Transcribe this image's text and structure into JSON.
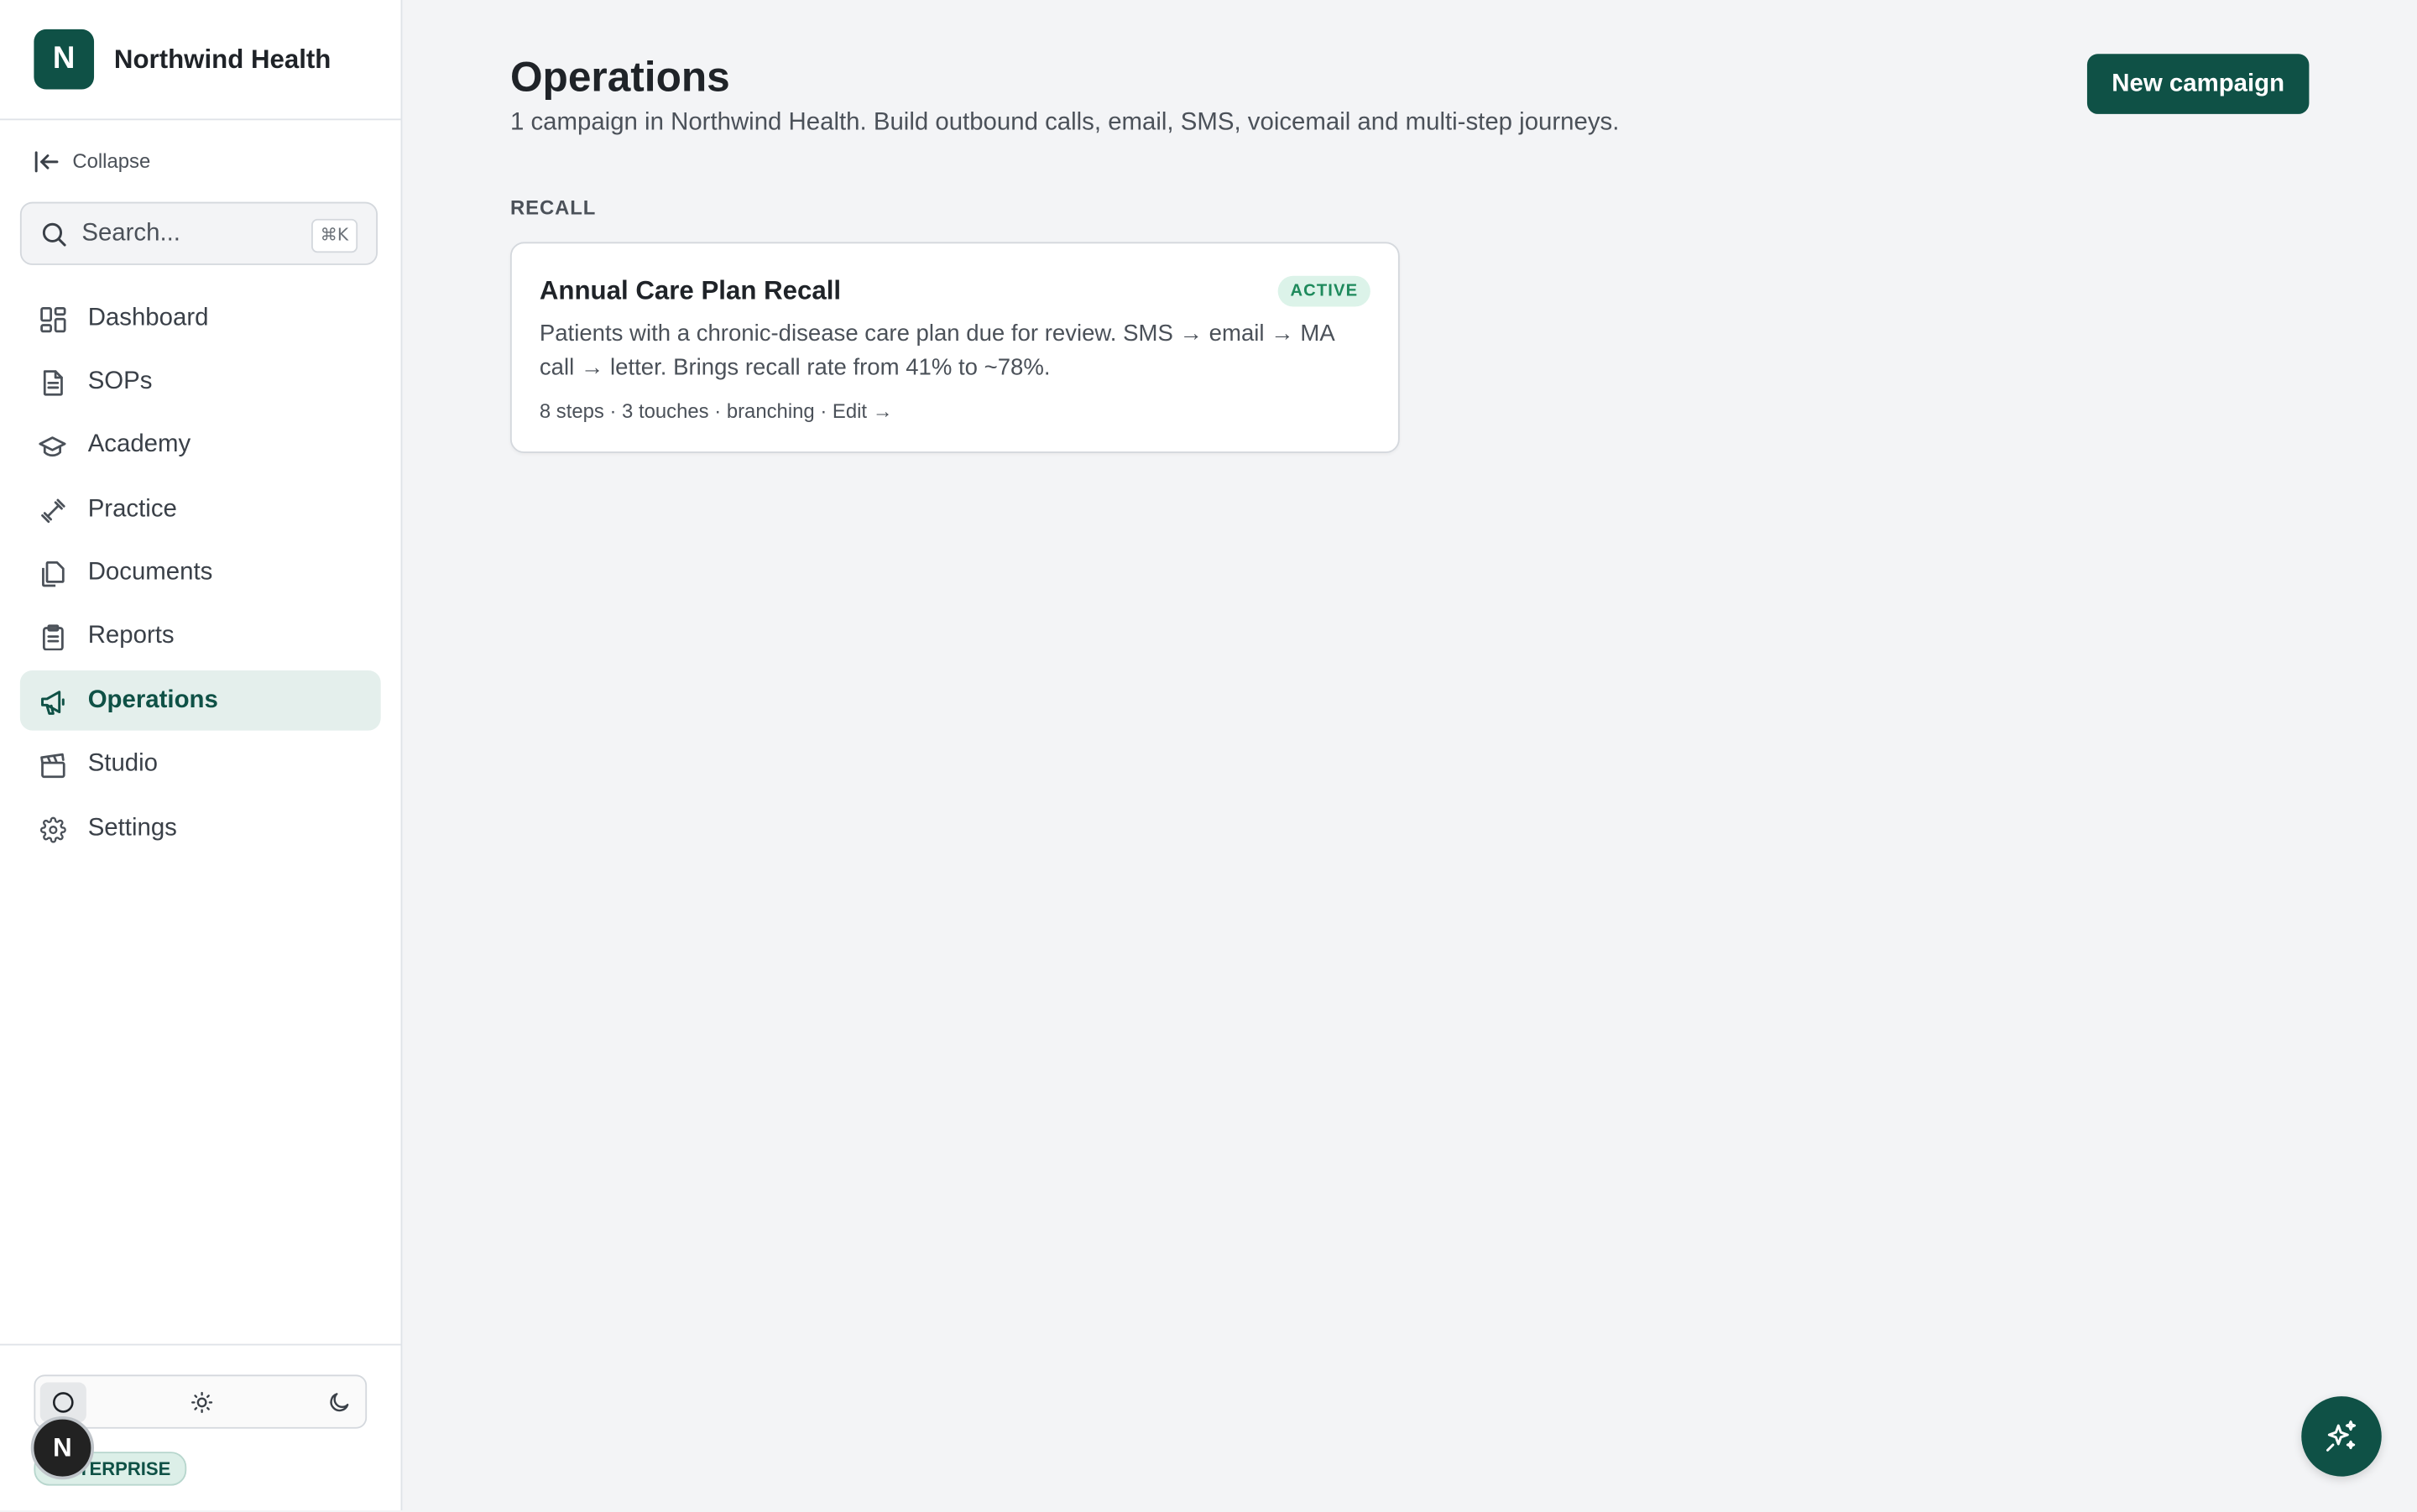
{
  "brand": {
    "logo_letter": "N",
    "name": "Northwind Health"
  },
  "sidebar": {
    "collapse_label": "Collapse",
    "search": {
      "placeholder": "Search...",
      "shortcut": "⌘K"
    },
    "items": [
      {
        "label": "Dashboard",
        "icon": "dashboard-icon",
        "active": false
      },
      {
        "label": "SOPs",
        "icon": "document-icon",
        "active": false
      },
      {
        "label": "Academy",
        "icon": "graduation-cap-icon",
        "active": false
      },
      {
        "label": "Practice",
        "icon": "dumbbell-icon",
        "active": false
      },
      {
        "label": "Documents",
        "icon": "files-icon",
        "active": false
      },
      {
        "label": "Reports",
        "icon": "clipboard-icon",
        "active": false
      },
      {
        "label": "Operations",
        "icon": "megaphone-icon",
        "active": true
      },
      {
        "label": "Studio",
        "icon": "clapperboard-icon",
        "active": false
      },
      {
        "label": "Settings",
        "icon": "gear-icon",
        "active": false
      }
    ],
    "theme_options": [
      {
        "icon": "system-theme-icon",
        "selected": true
      },
      {
        "icon": "sun-icon",
        "selected": false
      },
      {
        "icon": "moon-icon",
        "selected": false
      }
    ],
    "user": {
      "avatar_letter": "N",
      "plan_badge": "ENTERPRISE"
    }
  },
  "main": {
    "title": "Operations",
    "subtitle": "1 campaign in Northwind Health. Build outbound calls, email, SMS, voicemail and multi-step journeys.",
    "new_button_label": "New campaign",
    "sections": [
      {
        "label": "RECALL",
        "campaigns": [
          {
            "title": "Annual Care Plan Recall",
            "status": "ACTIVE",
            "description": "Patients with a chronic-disease care plan due for review. SMS → email → MA call → letter. Brings recall rate from 41% to ~78%.",
            "meta": "8 steps · 3 touches · branching · Edit →"
          }
        ]
      }
    ]
  },
  "assistant_button": {
    "icon": "sparkles-icon"
  },
  "colors": {
    "accent": "#0f5146",
    "active_nav_bg": "#e4efec",
    "status_active_text": "#1e8a5c",
    "status_active_bg": "#dcf3e9",
    "page_bg": "#f3f4f6"
  }
}
